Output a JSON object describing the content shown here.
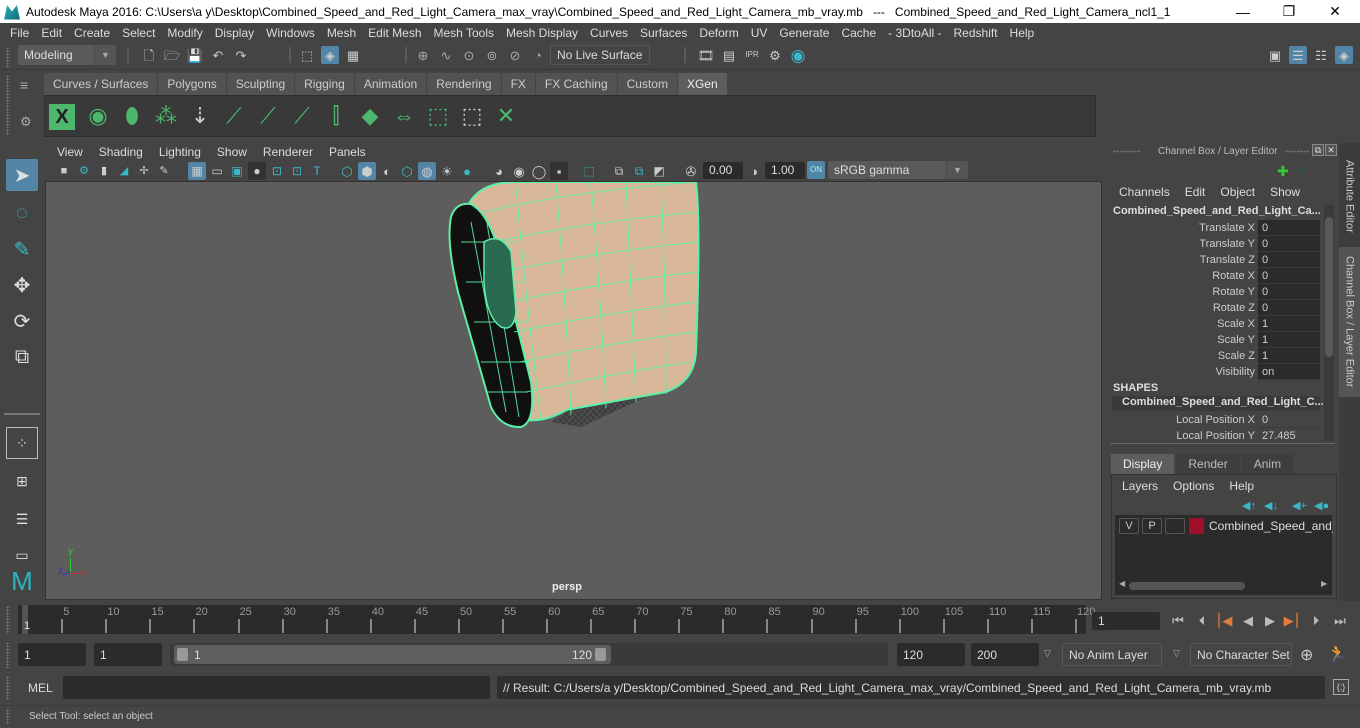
{
  "window": {
    "title": "Autodesk Maya 2016: C:\\Users\\a y\\Desktop\\Combined_Speed_and_Red_Light_Camera_max_vray\\Combined_Speed_and_Red_Light_Camera_mb_vray.mb   ---   Combined_Speed_and_Red_Light_Camera_ncl1_1",
    "minimize": "—",
    "maximize": "❐",
    "close": "✕"
  },
  "menubar": [
    "File",
    "Edit",
    "Create",
    "Select",
    "Modify",
    "Display",
    "Windows",
    "Mesh",
    "Edit Mesh",
    "Mesh Tools",
    "Mesh Display",
    "Curves",
    "Surfaces",
    "Deform",
    "UV",
    "Generate",
    "Cache",
    "- 3DtoAll -",
    "Redshift",
    "Help"
  ],
  "statusline": {
    "mode": "Modeling",
    "live_surface": "No Live Surface",
    "icons": [
      "new-scene-icon",
      "open-scene-icon",
      "save-scene-icon",
      "undo-icon",
      "redo-icon",
      "select-by-hierarchy-icon",
      "select-by-object-icon",
      "select-by-component-icon",
      "snap-to-grid-icon",
      "snap-to-curve-icon",
      "snap-to-point-icon",
      "snap-to-view-plane-icon",
      "snap-to-surface-icon",
      "make-live-icon",
      "render-view-icon",
      "render-current-frame-icon",
      "ipr-render-icon",
      "render-settings-icon",
      "hypershade-icon"
    ],
    "right_icons": [
      "modeling-toolkit-icon",
      "attribute-editor-icon",
      "tool-settings-icon",
      "channel-box-icon"
    ]
  },
  "shelf": {
    "tabs": [
      "Curves / Surfaces",
      "Polygons",
      "Sculpting",
      "Rigging",
      "Animation",
      "Rendering",
      "FX",
      "FX Caching",
      "Custom",
      "XGen"
    ],
    "active_tab": "XGen",
    "tools": [
      "xgen-editor-icon",
      "xgen-preview-icon",
      "xgen-clear-preview-icon",
      "create-description-icon",
      "place-guides-icon",
      "add-guide-icon",
      "guide-visibility-icon",
      "lock-guides-icon",
      "guide-sculpt-icon",
      "xgen-patches-icon",
      "guide-to-curves-icon",
      "select-guides-icon",
      "deselect-guides-icon",
      "delete-guides-icon"
    ]
  },
  "toolbox": [
    "select-tool-icon",
    "lasso-tool-icon",
    "paint-select-tool-icon",
    "move-tool-icon",
    "rotate-tool-icon",
    "scale-tool-icon",
    "single-perspective-layout-icon",
    "four-view-layout-icon",
    "outliner-layout-icon",
    "graph-layout-icon",
    "maya-logo-icon"
  ],
  "panel": {
    "menu": [
      "View",
      "Shading",
      "Lighting",
      "Show",
      "Renderer",
      "Panels"
    ],
    "exposure": "0.00",
    "gamma": "1.00",
    "color_mgmt": "ON",
    "colorspace": "sRGB gamma",
    "camera_label": "persp",
    "axis": {
      "x": "x",
      "y": "y",
      "z": "z"
    }
  },
  "channel_box": {
    "title": "Channel Box / Layer Editor",
    "menu": [
      "Channels",
      "Edit",
      "Object",
      "Show"
    ],
    "object_name": "Combined_Speed_and_Red_Light_Ca...",
    "channels": [
      {
        "label": "Translate X",
        "value": "0"
      },
      {
        "label": "Translate Y",
        "value": "0"
      },
      {
        "label": "Translate Z",
        "value": "0"
      },
      {
        "label": "Rotate X",
        "value": "0"
      },
      {
        "label": "Rotate Y",
        "value": "0"
      },
      {
        "label": "Rotate Z",
        "value": "0"
      },
      {
        "label": "Scale X",
        "value": "1"
      },
      {
        "label": "Scale Y",
        "value": "1"
      },
      {
        "label": "Scale Z",
        "value": "1"
      },
      {
        "label": "Visibility",
        "value": "on"
      }
    ],
    "shapes_header": "SHAPES",
    "shape_name": "Combined_Speed_and_Red_Light_C...",
    "shape_channels": [
      {
        "label": "Local Position X",
        "value": "0"
      },
      {
        "label": "Local Position Y",
        "value": "27.485"
      }
    ]
  },
  "layer_editor": {
    "tabs": [
      "Display",
      "Render",
      "Anim"
    ],
    "active_tab": "Display",
    "menu": [
      "Layers",
      "Options",
      "Help"
    ],
    "layers": [
      {
        "v": "V",
        "p": "P",
        "name": "Combined_Speed_and_R",
        "color": "#a0102a"
      }
    ]
  },
  "side_tabs": [
    "Attribute Editor",
    "Channel Box / Layer Editor"
  ],
  "timeline": {
    "ticks": [
      5,
      10,
      15,
      20,
      25,
      30,
      35,
      40,
      45,
      50,
      55,
      60,
      65,
      70,
      75,
      80,
      85,
      90,
      95,
      100,
      105,
      110,
      115,
      120
    ],
    "current_frame_marker": "1",
    "current_frame": "1",
    "range_start": "1",
    "range_playback_start": "1",
    "slider_start": "1",
    "slider_end": "120",
    "playback_end": "120",
    "range_end": "200",
    "anim_layer": "No Anim Layer",
    "character_set": "No Character Set"
  },
  "command": {
    "mel_label": "MEL",
    "mel_input": "",
    "result": "// Result: C:/Users/a y/Desktop/Combined_Speed_and_Red_Light_Camera_max_vray/Combined_Speed_and_Red_Light_Camera_mb_vray.mb"
  },
  "help_line": "Select Tool: select an object",
  "colors": {
    "accent": "#5285a6",
    "wireframe": "#5cf0a8",
    "model_surface": "#d8b898",
    "layer_color": "#a0102a",
    "key_marker": "#e07b39"
  }
}
